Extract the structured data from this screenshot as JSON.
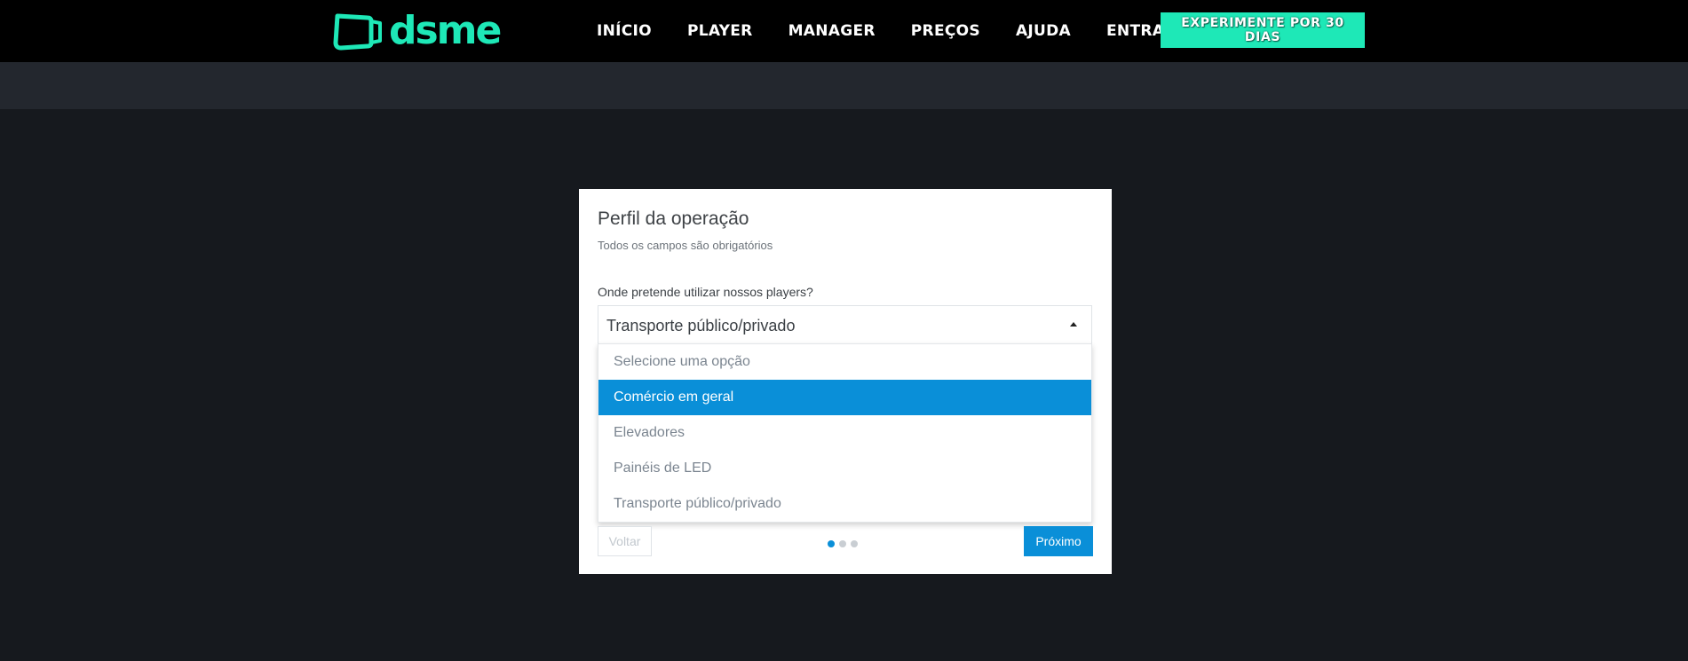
{
  "header": {
    "logo_text": "dsme",
    "logo_icon": "screen-logo-icon",
    "nav": [
      "INÍCIO",
      "PLAYER",
      "MANAGER",
      "PREÇOS",
      "AJUDA",
      "ENTRAR"
    ],
    "trial_label": "EXPERIMENTE POR 30 DIAS"
  },
  "form": {
    "title": "Perfil da operação",
    "subtitle": "Todos os campos são obrigatórios",
    "question": "Onde pretende utilizar nossos players?",
    "selected_value": "Transporte público/privado",
    "options": [
      "Selecione uma opção",
      "Comércio em geral",
      "Elevadores",
      "Painéis de LED",
      "Transporte público/privado"
    ],
    "highlighted_option": "Comércio em geral",
    "back_label": "Voltar",
    "next_label": "Próximo",
    "steps_total": 3,
    "current_step": 1
  },
  "colors": {
    "brand": "#1ee8b7",
    "accent": "#0a8fd8",
    "background": "#16191e",
    "topbar": "#000000",
    "subbar": "#23272e"
  }
}
